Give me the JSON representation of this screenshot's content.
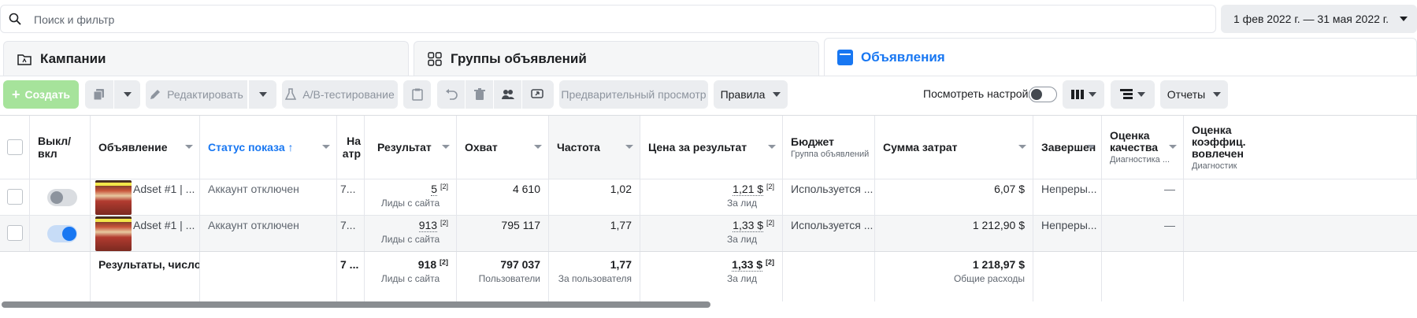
{
  "search": {
    "placeholder": "Поиск и фильтр",
    "value": ""
  },
  "date_range": "1 фев 2022 г. — 31 мая 2022 г.",
  "tabs": [
    {
      "label": "Кампании"
    },
    {
      "label": "Группы объявлений"
    },
    {
      "label": "Объявления"
    }
  ],
  "toolbar": {
    "create": "Создать",
    "edit": "Редактировать",
    "ab_test": "A/B-тестирование",
    "preview": "Предварительный просмотр",
    "rules": "Правила",
    "view_settings": "Посмотреть настройки",
    "reports": "Отчеты"
  },
  "columns": {
    "toggle": "Выкл/ вкл",
    "ad": "Объявление",
    "status": "Статус показа",
    "attr": "На атр",
    "result": "Результат",
    "reach": "Охват",
    "frequency": "Частота",
    "cost_per_result": "Цена за результат",
    "budget": "Бюджет",
    "budget_sub": "Группа объявлений",
    "amount_spent": "Сумма затрат",
    "ends": "Завершен",
    "quality": "Оценка качества",
    "quality_sub": "Диагностика ...",
    "engagement": "Оценка коэффиц. вовлечен",
    "engagement_sub": "Диагностик"
  },
  "rows": [
    {
      "enabled": false,
      "ad": "Adset #1 | ...",
      "status": "Аккаунт отключен",
      "attr": "7...",
      "result": "5",
      "result_sup": "[2]",
      "result_sub": "Лиды с сайта",
      "reach": "4 610",
      "frequency": "1,02",
      "cost": "1,21 $",
      "cost_sup": "[2]",
      "cost_sub": "За лид",
      "budget": "Используется ...",
      "spent": "6,07 $",
      "ends": "Непреры...",
      "quality": "—"
    },
    {
      "enabled": true,
      "ad": "Adset #1 | ...",
      "status": "Аккаунт отключен",
      "attr": "7...",
      "result": "913",
      "result_sup": "[2]",
      "result_sub": "Лиды с сайта",
      "reach": "795 117",
      "frequency": "1,77",
      "cost": "1,33 $",
      "cost_sup": "[2]",
      "cost_sub": "За лид",
      "budget": "Используется ...",
      "spent": "1 212,90 $",
      "ends": "Непреры...",
      "quality": "—"
    }
  ],
  "totals": {
    "label": "Результаты, число...",
    "attr": "7 ...",
    "result": "918",
    "result_sup": "[2]",
    "result_sub": "Лиды с сайта",
    "reach": "797 037",
    "reach_sub": "Пользователи",
    "frequency": "1,77",
    "frequency_sub": "За пользователя",
    "cost": "1,33 $",
    "cost_sup": "[2]",
    "cost_sub": "За лид",
    "spent": "1 218,97 $",
    "spent_sub": "Общие расходы"
  },
  "colors": {
    "accent": "#1877f2",
    "create_button": "#a6e39b"
  }
}
